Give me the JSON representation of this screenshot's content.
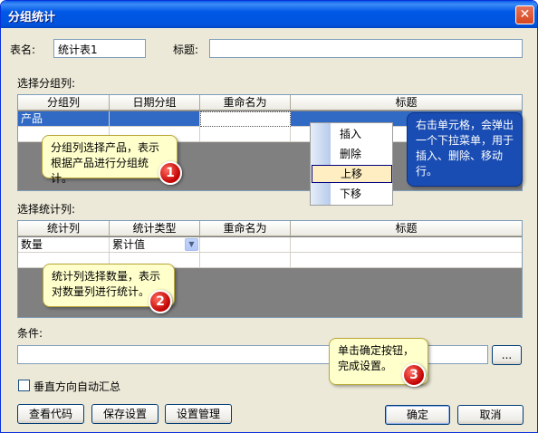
{
  "window": {
    "title": "分组统计",
    "close_glyph": "✕"
  },
  "form": {
    "table_name_label": "表名:",
    "table_name_value": "统计表1",
    "title_label": "标题:",
    "title_value": ""
  },
  "group_section": {
    "label": "选择分组列:",
    "headers": [
      "分组列",
      "日期分组",
      "重命名为",
      "标题"
    ],
    "rows": [
      [
        "产品",
        "",
        "",
        ""
      ],
      [
        "",
        "",
        "",
        ""
      ]
    ]
  },
  "context_menu": {
    "items": [
      {
        "label": "插入",
        "active": false
      },
      {
        "label": "删除",
        "active": false
      },
      {
        "label": "上移",
        "active": true
      },
      {
        "label": "下移",
        "active": false
      }
    ]
  },
  "stat_section": {
    "label": "选择统计列:",
    "headers": [
      "统计列",
      "统计类型",
      "重命名为",
      "标题"
    ],
    "rows": [
      [
        "数量",
        "累计值",
        "",
        ""
      ],
      [
        "",
        "",
        "",
        ""
      ]
    ]
  },
  "condition": {
    "label": "条件:",
    "value": "",
    "browse_label": "..."
  },
  "auto_sum": {
    "label": "垂直方向自动汇总",
    "checked": false
  },
  "buttons": {
    "view_code": "查看代码",
    "save_settings": "保存设置",
    "manage_settings": "设置管理",
    "ok": "确定",
    "cancel": "取消"
  },
  "tooltips": {
    "tip1": "分组列选择产品，表示根据产品进行分组统计。",
    "tip2": "右击单元格，会弹出一个下拉菜单，用于插入、删除、移动行。",
    "tip3": "统计列选择数量，表示对数量列进行统计。",
    "tip4": "单击确定按钮，完成设置。"
  },
  "badges": {
    "b1": "1",
    "b2": "2",
    "b3": "3"
  }
}
